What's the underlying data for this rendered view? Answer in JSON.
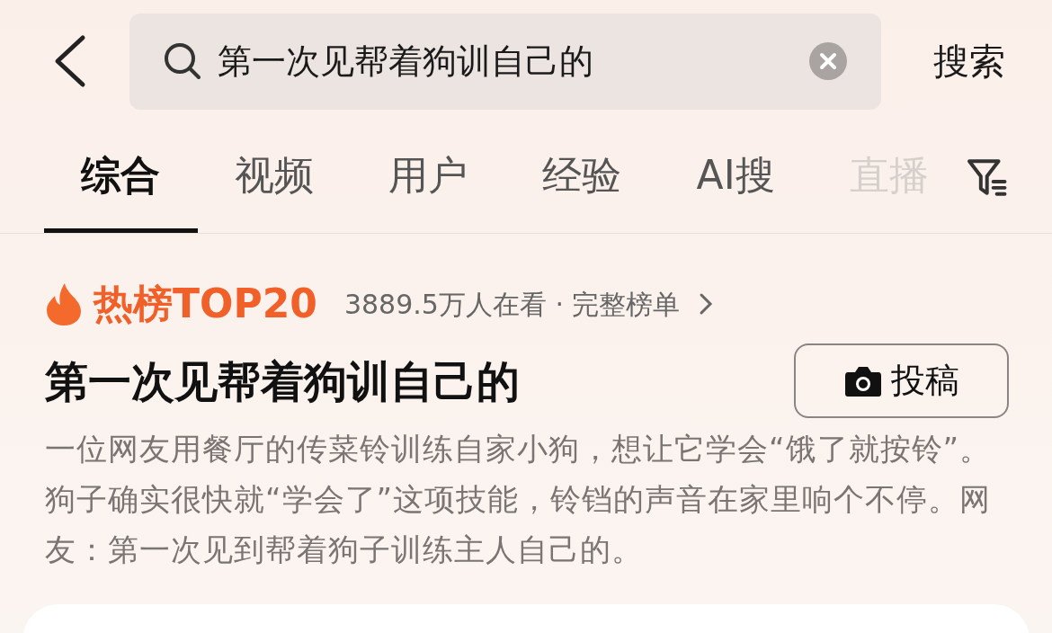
{
  "search": {
    "value": "第一次见帮着狗训自己的",
    "submit": "搜索"
  },
  "tabs": [
    {
      "label": "综合",
      "selected": true,
      "faded": false
    },
    {
      "label": "视频",
      "selected": false,
      "faded": false
    },
    {
      "label": "用户",
      "selected": false,
      "faded": false
    },
    {
      "label": "经验",
      "selected": false,
      "faded": false
    },
    {
      "label": "AI搜",
      "selected": false,
      "faded": false
    },
    {
      "label": "直播",
      "selected": false,
      "faded": true
    }
  ],
  "hot": {
    "badge": "热榜TOP20",
    "viewers": "3889.5万人在看 · 完整榜单",
    "title": "第一次见帮着狗训自己的",
    "post_button": "投稿",
    "summary": "一位网友用餐厅的传菜铃训练自家小狗，想让它学会“饿了就按铃”。狗子确实很快就“学会了”这项技能，铃铛的声音在家里响个不停。网友：第一次见到帮着狗子训练主人自己的。"
  }
}
